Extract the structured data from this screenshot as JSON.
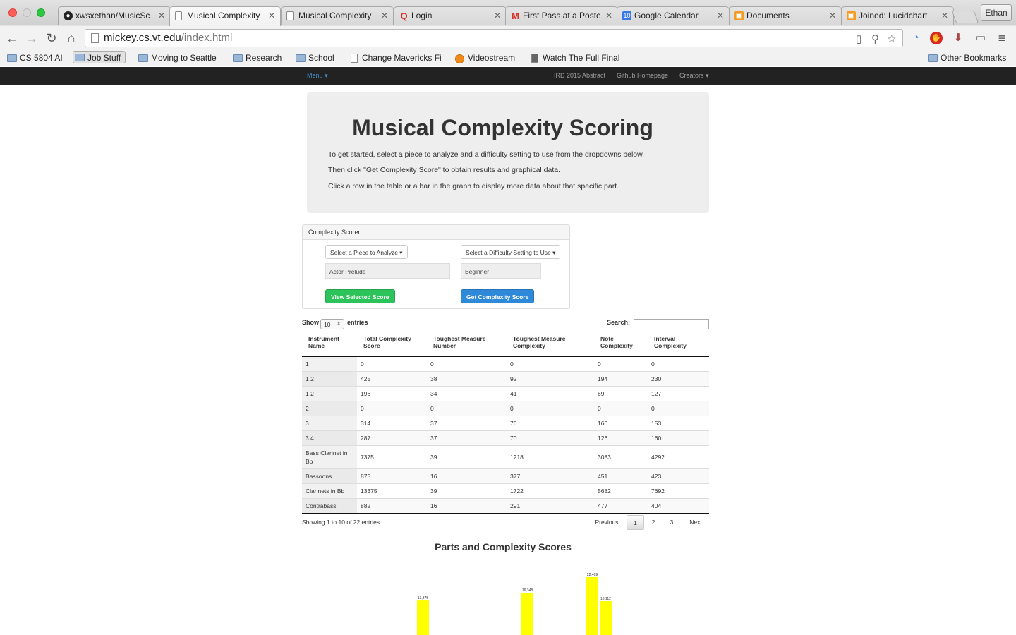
{
  "browser": {
    "tabs": [
      {
        "title": "xwsxethan/MusicSc",
        "icon": "github-icon",
        "color": "#222222"
      },
      {
        "title": "Musical Complexity",
        "icon": "page-icon",
        "color": "#888888",
        "active": true
      },
      {
        "title": "Musical Complexity",
        "icon": "page-icon",
        "color": "#888888"
      },
      {
        "title": "Login",
        "icon": "q-logo-icon",
        "color": "#d9302b"
      },
      {
        "title": "First Pass at a Poste",
        "icon": "gmail-icon",
        "color": "#d93025"
      },
      {
        "title": "Google Calendar",
        "icon": "calendar-icon",
        "color": "#3b78e7"
      },
      {
        "title": "Documents",
        "icon": "lucidchart-icon",
        "color": "#f59b22"
      },
      {
        "title": "Joined: Lucidchart",
        "icon": "lucidchart-icon",
        "color": "#f59b22"
      }
    ],
    "profile": "Ethan",
    "url_host": "mickey.cs.vt.edu",
    "url_path": "/index.html",
    "bookmarks": [
      {
        "label": "CS 5804 AI",
        "icon": "folder-icon"
      },
      {
        "label": "Job Stuff",
        "icon": "folder-icon",
        "active": true
      },
      {
        "label": "Moving to Seattle",
        "icon": "folder-icon"
      },
      {
        "label": "Research",
        "icon": "folder-icon"
      },
      {
        "label": "School",
        "icon": "folder-icon"
      },
      {
        "label": "Change Mavericks Fi",
        "icon": "document-icon"
      },
      {
        "label": "Videostream",
        "icon": "play-icon"
      },
      {
        "label": "Watch The Full Final",
        "icon": "document-icon"
      }
    ],
    "other_bookmarks": "Other Bookmarks"
  },
  "navbar": {
    "menu": "Menu",
    "links": [
      "IRD 2015 Abstract",
      "Github Homepage",
      "Creators"
    ]
  },
  "jumbotron": {
    "title": "Musical Complexity Scoring",
    "lines": [
      "To get started, select a piece to analyze and a difficulty setting to use from the dropdowns below.",
      "Then click \"Get Complexity Score\" to obtain results and graphical data.",
      "Click a row in the table or a bar in the graph to display more data about that specific part."
    ]
  },
  "scorer": {
    "heading": "Complexity Scorer",
    "piece_dropdown": "Select a Piece to Analyze",
    "difficulty_dropdown": "Select a Difficulty Setting to Use",
    "piece_value": "Actor Prelude",
    "difficulty_value": "Beginner",
    "view_button": "View Selected Score",
    "get_button": "Get Complexity Score"
  },
  "table": {
    "show_label": "Show",
    "entries_label": "entries",
    "page_length": "10",
    "search_label": "Search:",
    "columns": [
      "Instrument Name",
      "Total Complexity Score",
      "Toughest Measure Number",
      "Toughest Measure Complexity",
      "Note Complexity",
      "Interval Complexity"
    ],
    "rows": [
      [
        "1",
        "0",
        "0",
        "0",
        "0",
        "0"
      ],
      [
        "1 2",
        "425",
        "38",
        "92",
        "194",
        "230"
      ],
      [
        "1 2",
        "196",
        "34",
        "41",
        "69",
        "127"
      ],
      [
        "2",
        "0",
        "0",
        "0",
        "0",
        "0"
      ],
      [
        "3",
        "314",
        "37",
        "76",
        "160",
        "153"
      ],
      [
        "3 4",
        "287",
        "37",
        "70",
        "126",
        "160"
      ],
      [
        "Bass Clarinet in Bb",
        "7375",
        "39",
        "1218",
        "3083",
        "4292"
      ],
      [
        "Bassoons",
        "875",
        "16",
        "377",
        "451",
        "423"
      ],
      [
        "Clarinets in Bb",
        "13375",
        "39",
        "1722",
        "5682",
        "7692"
      ],
      [
        "Contrabass",
        "882",
        "16",
        "291",
        "477",
        "404"
      ]
    ],
    "info": "Showing 1 to 10 of 22 entries",
    "pagination": {
      "previous": "Previous",
      "pages": [
        "1",
        "2",
        "3"
      ],
      "current": "1",
      "next": "Next"
    }
  },
  "chart_data": {
    "type": "bar",
    "title": "Parts and Complexity Scores",
    "bar_color": "#ffff00",
    "bars": [
      {
        "value": 13375,
        "label": "13,375"
      },
      {
        "value": 16348,
        "label": "16,348"
      },
      {
        "value": 22409,
        "label": "22,409"
      },
      {
        "value": 13112,
        "label": "13,112"
      }
    ]
  }
}
